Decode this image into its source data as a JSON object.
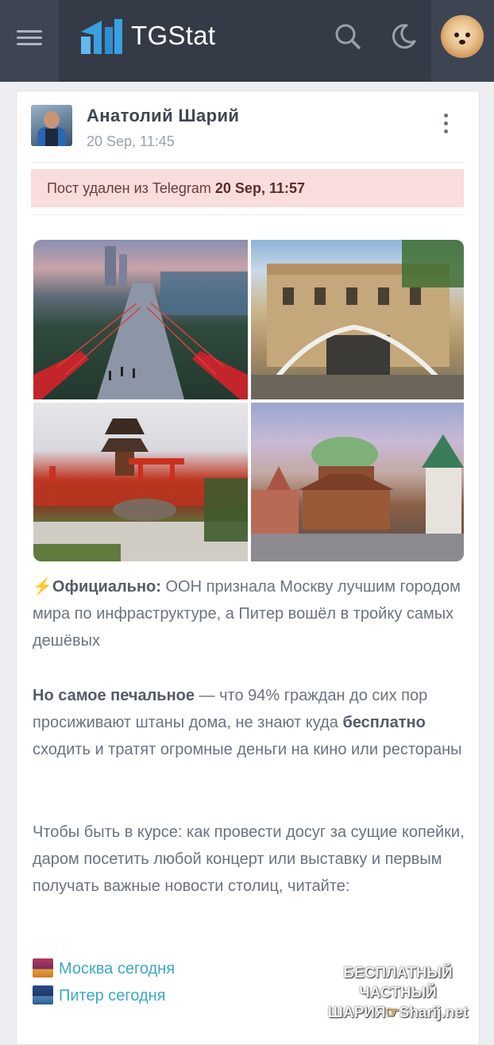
{
  "header": {
    "brand": "TGStat",
    "menu_icon": "hamburger-icon",
    "logo_icon": "tgstat-logo-icon",
    "search_icon": "search-icon",
    "theme_icon": "moon-icon",
    "user_avatar": "user-avatar"
  },
  "post": {
    "author": "Анатолий Шарий",
    "date": "20 Sep, 11:45",
    "menu_icon": "kebab-menu-icon",
    "deleted_notice": {
      "prefix": "Пост удален из Telegram ",
      "date": "20 Sep, 11:57"
    },
    "photos": [
      {
        "name": "photo-bridge-aerial"
      },
      {
        "name": "photo-palace-staircase"
      },
      {
        "name": "photo-japanese-garden"
      },
      {
        "name": "photo-wooden-kremlin"
      }
    ],
    "paragraphs": {
      "p1_emoji": "⚡",
      "p1_bold": "Официально:",
      "p1_text": " ООН признала Москву лучшим городом мира по инфраструктуре, а Питер вошёл в тройку самых дешёвых",
      "p2_bold": "Но самое печальное",
      "p2_text_a": " — что 94% граждан до сих пор просиживают штаны дома, не знают куда ",
      "p2_bold_b": "бесплатно",
      "p2_text_b": " сходить и тратят огромные деньги на кино или рестораны",
      "p3_text": "Чтобы быть в курсе: как провести досуг за сущие копейки, даром посетить любой концерт или выставку и первым получать важные новости столиц, читайте:"
    },
    "links": [
      {
        "label": "Москва сегодня",
        "icon": "moscow-flag-icon"
      },
      {
        "label": "Питер сегодня",
        "icon": "spb-flag-icon"
      }
    ]
  },
  "watermark": {
    "line1": "БЕСПЛАТНЫЙ ЧАСТНЫЙ",
    "line2_a": "ШАРИЯ",
    "line2_b": "Sharij.net",
    "hand_icon": "pointing-hand-icon"
  },
  "colors": {
    "topbar": "#343a46",
    "alert_bg": "#f9dcdc",
    "link": "#3ba9c6"
  }
}
